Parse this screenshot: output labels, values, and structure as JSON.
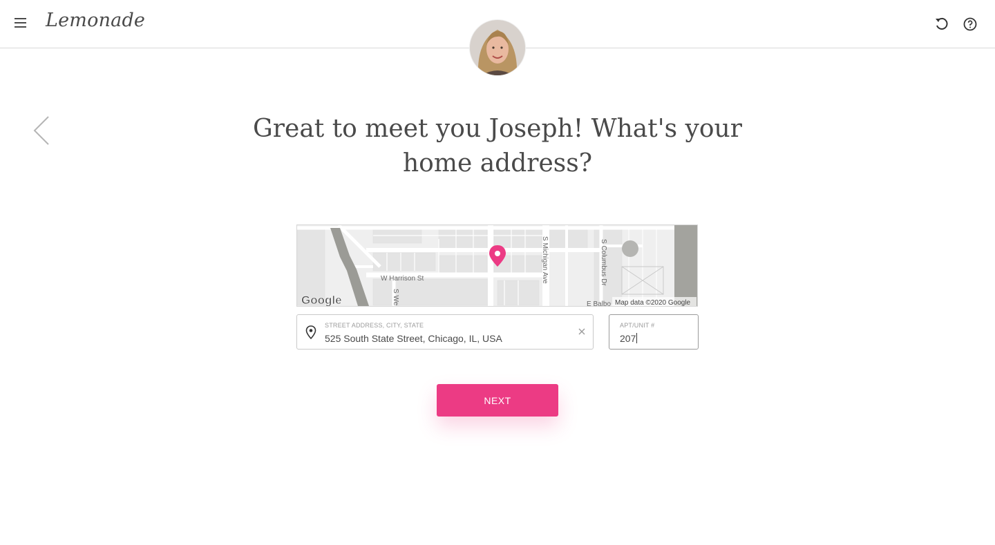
{
  "header": {
    "logo_text": "Lemonade",
    "menu_icon": "hamburger-icon",
    "restart_icon": "restart-icon",
    "help_icon": "help-icon"
  },
  "avatar": {
    "icon": "avatar-photo"
  },
  "question": {
    "line1": "Great to meet you Joseph! What's your",
    "line2": "home address?"
  },
  "map": {
    "streets": [
      "W Harrison St",
      "S Wells",
      "S Michigan Ave",
      "S Columbus Dr",
      "E Balbo"
    ],
    "attribution": "Map data ©2020 Google",
    "logo": "Google",
    "pin_color": "#ec3b84"
  },
  "address_field": {
    "label": "STREET ADDRESS, CITY, STATE",
    "value": "525 South State Street, Chicago, IL, USA"
  },
  "apt_field": {
    "label": "APT/UNIT #",
    "value": "207"
  },
  "next_button": {
    "label": "NEXT"
  },
  "colors": {
    "accent": "#ec3b84",
    "text": "#4a4a4a"
  }
}
